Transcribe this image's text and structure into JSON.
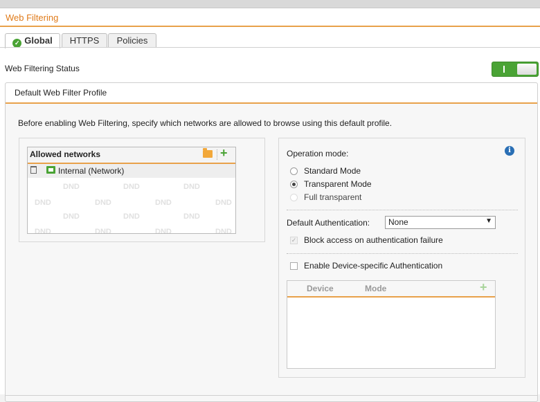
{
  "page": {
    "title": "Web Filtering"
  },
  "tabs": [
    {
      "label": "Global",
      "active": true
    },
    {
      "label": "HTTPS",
      "active": false
    },
    {
      "label": "Policies",
      "active": false
    }
  ],
  "status": {
    "label": "Web Filtering Status",
    "toggle_on": true,
    "toggle_color": "#4aa335"
  },
  "profile": {
    "title": "Default Web Filter Profile",
    "description": "Before enabling Web Filtering, specify which networks are allowed to browse using this default profile."
  },
  "allowed_networks": {
    "title": "Allowed networks",
    "items": [
      {
        "label": "Internal (Network)",
        "icon": "network-icon"
      }
    ],
    "watermark": "DND"
  },
  "operation": {
    "label": "Operation mode:",
    "options": [
      {
        "label": "Standard Mode",
        "checked": false,
        "disabled": false
      },
      {
        "label": "Transparent Mode",
        "checked": true,
        "disabled": false
      },
      {
        "label": "Full transparent",
        "checked": false,
        "disabled": true
      }
    ]
  },
  "auth": {
    "label": "Default Authentication:",
    "selected": "None",
    "block_label": "Block access on authentication failure",
    "block_checked": true,
    "device_auth_label": "Enable Device-specific Authentication",
    "device_auth_checked": false
  },
  "device_table": {
    "columns": [
      "Device",
      "Mode"
    ]
  },
  "colors": {
    "accent": "#e07b1a",
    "rule": "#e8a14a",
    "green": "#4aa335",
    "info": "#2a6fb5"
  }
}
